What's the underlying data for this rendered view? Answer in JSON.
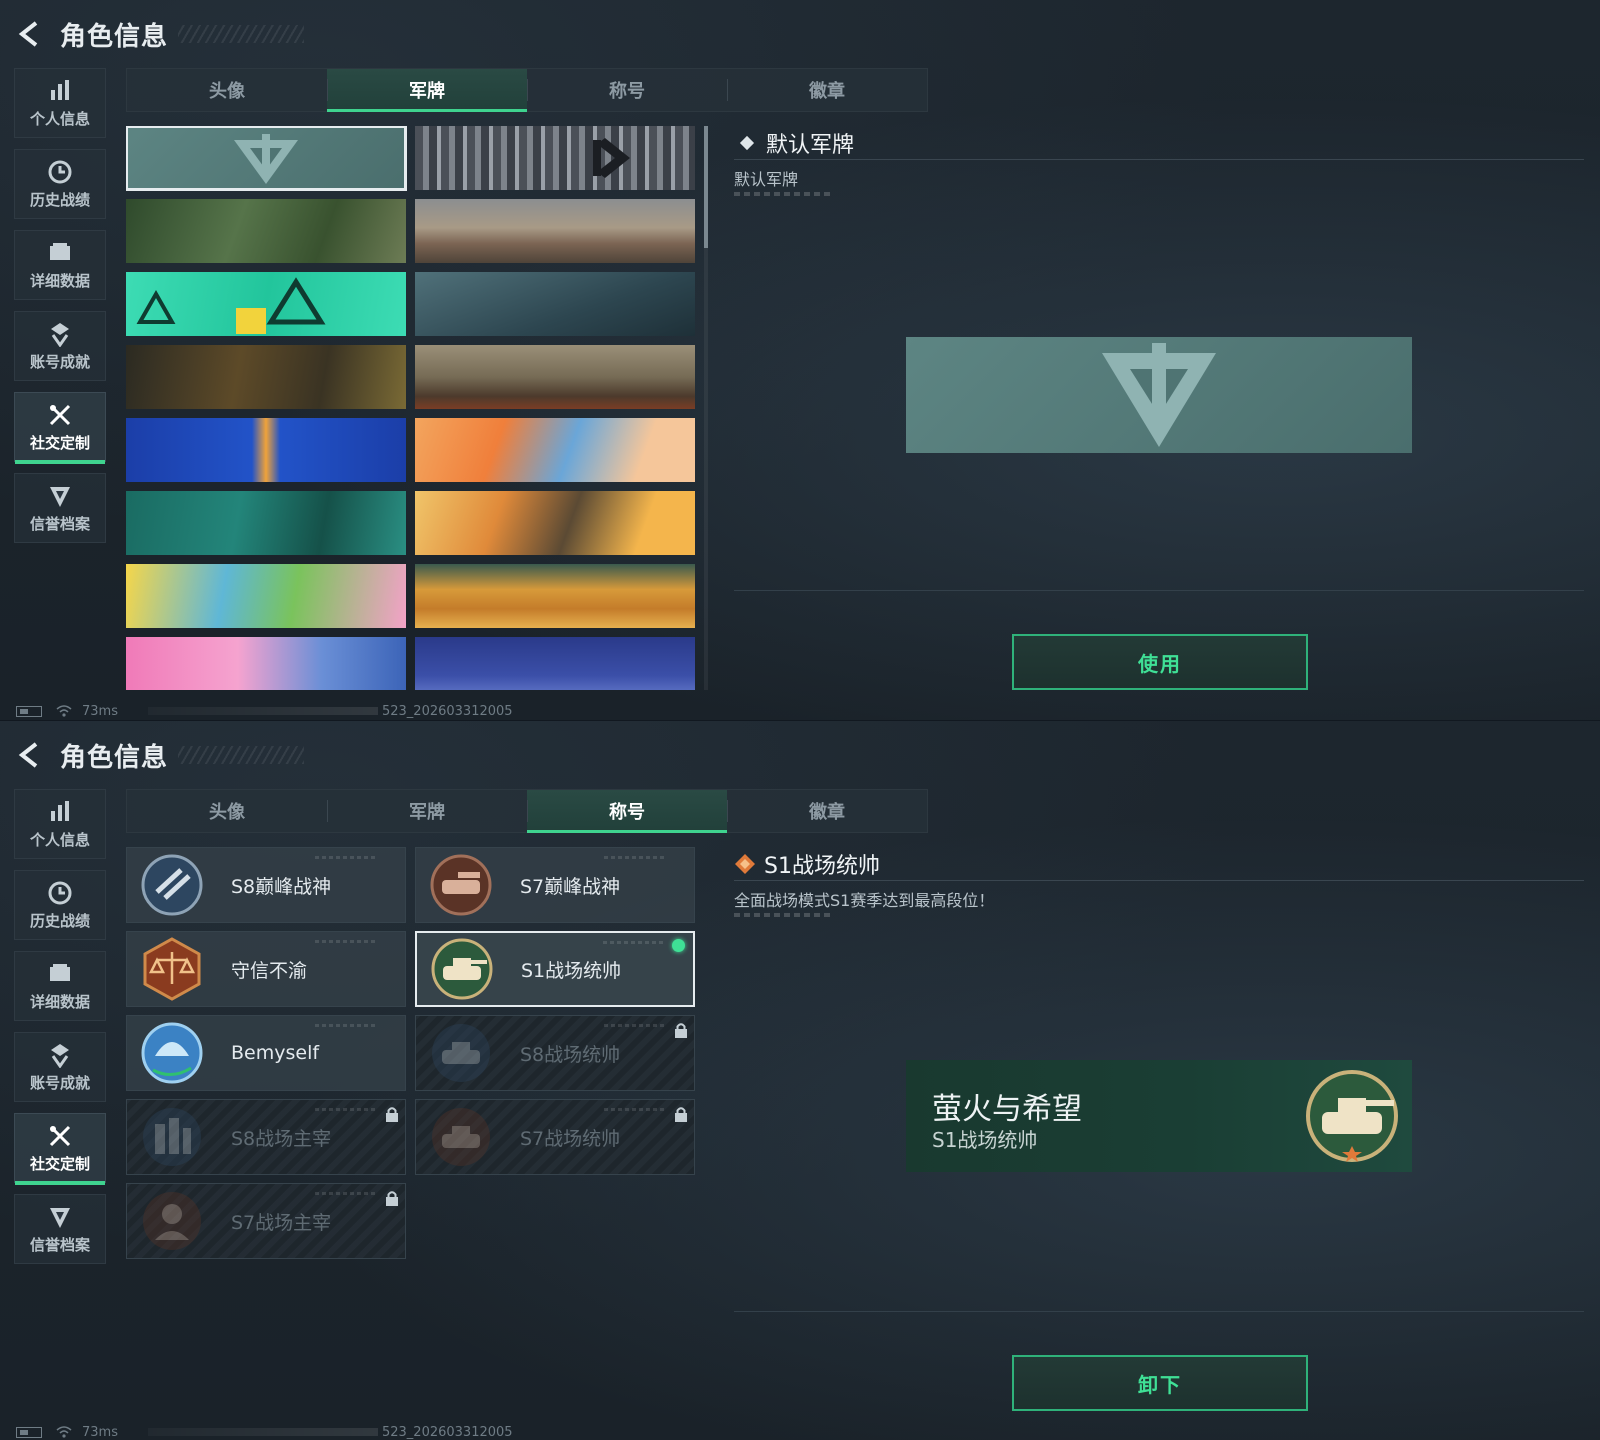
{
  "screens": [
    {
      "header": {
        "title": "角色信息"
      },
      "sidebar": [
        {
          "label": "个人信息",
          "icon": "bar-chart-icon"
        },
        {
          "label": "历史战绩",
          "icon": "clock-icon"
        },
        {
          "label": "详细数据",
          "icon": "folder-icon"
        },
        {
          "label": "账号成就",
          "icon": "achievement-icon"
        },
        {
          "label": "社交定制",
          "icon": "tools-icon",
          "active": true
        },
        {
          "label": "信誉档案",
          "icon": "credit-icon"
        }
      ],
      "tabs": [
        {
          "label": "头像"
        },
        {
          "label": "军牌",
          "active": true
        },
        {
          "label": "称号"
        },
        {
          "label": "徽章"
        }
      ],
      "detail": {
        "title": "默认军牌",
        "description": "默认军牌",
        "action_label": "使用"
      },
      "status": {
        "ping": "73ms",
        "build": "523_202603312005"
      }
    },
    {
      "header": {
        "title": "角色信息"
      },
      "sidebar": [
        {
          "label": "个人信息",
          "icon": "bar-chart-icon"
        },
        {
          "label": "历史战绩",
          "icon": "clock-icon"
        },
        {
          "label": "详细数据",
          "icon": "folder-icon"
        },
        {
          "label": "账号成就",
          "icon": "achievement-icon"
        },
        {
          "label": "社交定制",
          "icon": "tools-icon",
          "active": true
        },
        {
          "label": "信誉档案",
          "icon": "credit-icon"
        }
      ],
      "tabs": [
        {
          "label": "头像"
        },
        {
          "label": "军牌"
        },
        {
          "label": "称号",
          "active": true
        },
        {
          "label": "徽章"
        }
      ],
      "titles": [
        {
          "label": "S8巅峰战神",
          "locked": false
        },
        {
          "label": "S7巅峰战神",
          "locked": false
        },
        {
          "label": "守信不渝",
          "locked": false
        },
        {
          "label": "S1战场统帅",
          "locked": false,
          "selected": true,
          "equipped": true
        },
        {
          "label": "Bemyself",
          "locked": false
        },
        {
          "label": "S8战场统帅",
          "locked": true
        },
        {
          "label": "S8战场主宰",
          "locked": true
        },
        {
          "label": "S7战场统帅",
          "locked": true
        },
        {
          "label": "S7战场主宰",
          "locked": true
        }
      ],
      "detail": {
        "title": "S1战场统帅",
        "description": "全面战场模式S1赛季达到最高段位！",
        "card_name": "萤火与希望",
        "card_title": "S1战场统帅",
        "action_label": "卸下"
      },
      "status": {
        "ping": "73ms",
        "build": "523_202603312005"
      }
    }
  ],
  "colors": {
    "accent": "#3fd38f",
    "button_text": "#3fe096",
    "selected_border": "#e6ecef"
  }
}
